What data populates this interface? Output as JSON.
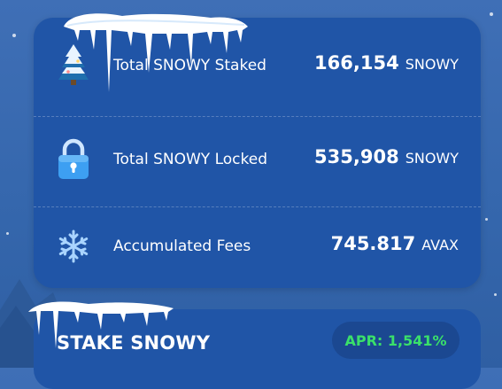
{
  "stats": {
    "total_staked": {
      "label": "Total SNOWY Staked",
      "value": "166,154",
      "unit": "SNOWY",
      "icon": "snowy-tree-icon"
    },
    "total_locked": {
      "label": "Total SNOWY Locked",
      "value": "535,908",
      "unit": "SNOWY",
      "icon": "lock-icon"
    },
    "accumulated_fees": {
      "label": "Accumulated Fees",
      "value": "745.817",
      "unit": "AVAX",
      "icon": "snowflake-icon"
    }
  },
  "stake": {
    "title": "STAKE SNOWY",
    "apr_label": "APR: 1,541%"
  },
  "colors": {
    "background": "#3567ad",
    "card": "#2055a7",
    "apr_badge_bg": "#1b4891",
    "apr_text": "#3ae06a"
  }
}
